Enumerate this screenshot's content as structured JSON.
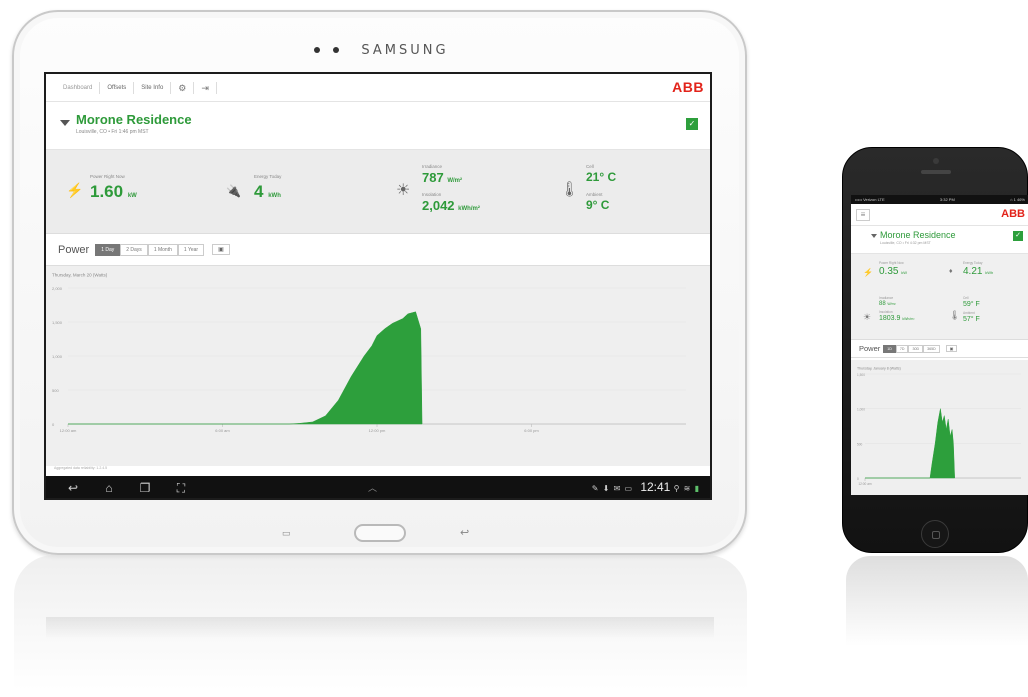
{
  "tablet": {
    "brand": "SAMSUNG",
    "top_tabs": [
      "Dashboard",
      "Offsets",
      "Site Info"
    ],
    "settings_icon": "gear-icon",
    "logout_icon": "logout-icon",
    "logo": "ABB",
    "site": {
      "name": "Morone Residence",
      "subtitle": "Louisville, CO • Fri 1:46 pm MST"
    },
    "stats": {
      "power_label": "Power Right Now",
      "power_value": "1.60",
      "power_unit": "kW",
      "energy_label": "Energy Today",
      "energy_value": "4",
      "energy_unit": "kWh",
      "irradiance_label": "Irradiance",
      "irradiance_value": "787",
      "irradiance_unit": "W/m²",
      "insolation_label": "Insolation",
      "insolation_value": "2,042",
      "insolation_unit": "kWh/m²",
      "cell_label": "Cell",
      "cell_value": "21° C",
      "ambient_label": "Ambient",
      "ambient_value": "9° C"
    },
    "power": {
      "label": "Power",
      "ranges": [
        "1 Day",
        "2 Days",
        "1 Month",
        "1 Year"
      ],
      "active_range": "1 Day"
    },
    "chart_title": "Thursday, March 20 (Watts)",
    "footer": "Aggregated data reliability: 1.2.4.5",
    "nav": {
      "time": "12:41"
    },
    "colors": {
      "accent": "#2e9a3a",
      "brand_red": "#e2231a",
      "nav_bg": "#111111"
    }
  },
  "phone": {
    "status_left": "••••• Verizon LTE",
    "status_time": "3:32 PM",
    "status_right": "⌂ 1 46%",
    "logo": "ABB",
    "site": {
      "name": "Morone Residence",
      "subtitle": "Louisville, CO • Fri 4:32 pm MST"
    },
    "stats": {
      "power_label": "Power Right Now",
      "power_value": "0.35",
      "power_unit": "kW",
      "energy_label": "Energy Today",
      "energy_value": "4.21",
      "energy_unit": "kWh",
      "irradiance_label": "Irradiance",
      "irradiance_value": "88",
      "irradiance_unit": "W/m²",
      "insolation_label": "Insolation",
      "insolation_value": "1803.9",
      "insolation_unit": "kWh/m²",
      "cell_label": "Cell",
      "cell_value": "59° F",
      "ambient_label": "Ambient",
      "ambient_value": "57° F"
    },
    "power": {
      "label": "Power",
      "ranges": [
        "1D",
        "7D",
        "30D",
        "365D"
      ],
      "active_range": "1D"
    },
    "chart_title": "Thursday, January 8 (Watts)"
  },
  "chart_data": [
    {
      "type": "area",
      "title": "Thursday, March 20 (Watts)",
      "x_ticks": [
        "12:00 am",
        "6:00 am",
        "12:00 pm",
        "6:00 pm"
      ],
      "y_ticks": [
        0,
        500,
        1000,
        1500,
        2000
      ],
      "ylim": [
        0,
        2000
      ],
      "x_hours": [
        0,
        8.6,
        9.0,
        9.5,
        10.0,
        10.5,
        11.0,
        11.5,
        11.8,
        12.0,
        12.3,
        12.6,
        13.0,
        13.2,
        13.5,
        13.7,
        13.75
      ],
      "values": [
        0,
        0,
        10,
        30,
        120,
        350,
        700,
        1000,
        1150,
        1300,
        1400,
        1480,
        1550,
        1620,
        1650,
        1400,
        0
      ],
      "color": "#2d9f3c"
    },
    {
      "type": "area",
      "title": "Thursday, January 8 (Watts)",
      "x_ticks": [
        "12:00 am"
      ],
      "y_ticks": [
        0,
        500,
        1000,
        1500
      ],
      "ylim": [
        0,
        1500
      ],
      "x_hours": [
        0,
        10.0,
        10.3,
        10.8,
        11.2,
        11.6,
        11.9,
        12.2,
        12.5,
        12.8,
        13.1,
        13.4,
        13.6,
        13.8
      ],
      "values": [
        0,
        0,
        200,
        500,
        800,
        1000,
        800,
        900,
        700,
        850,
        600,
        700,
        500,
        0
      ],
      "color": "#2d9f3c"
    }
  ]
}
